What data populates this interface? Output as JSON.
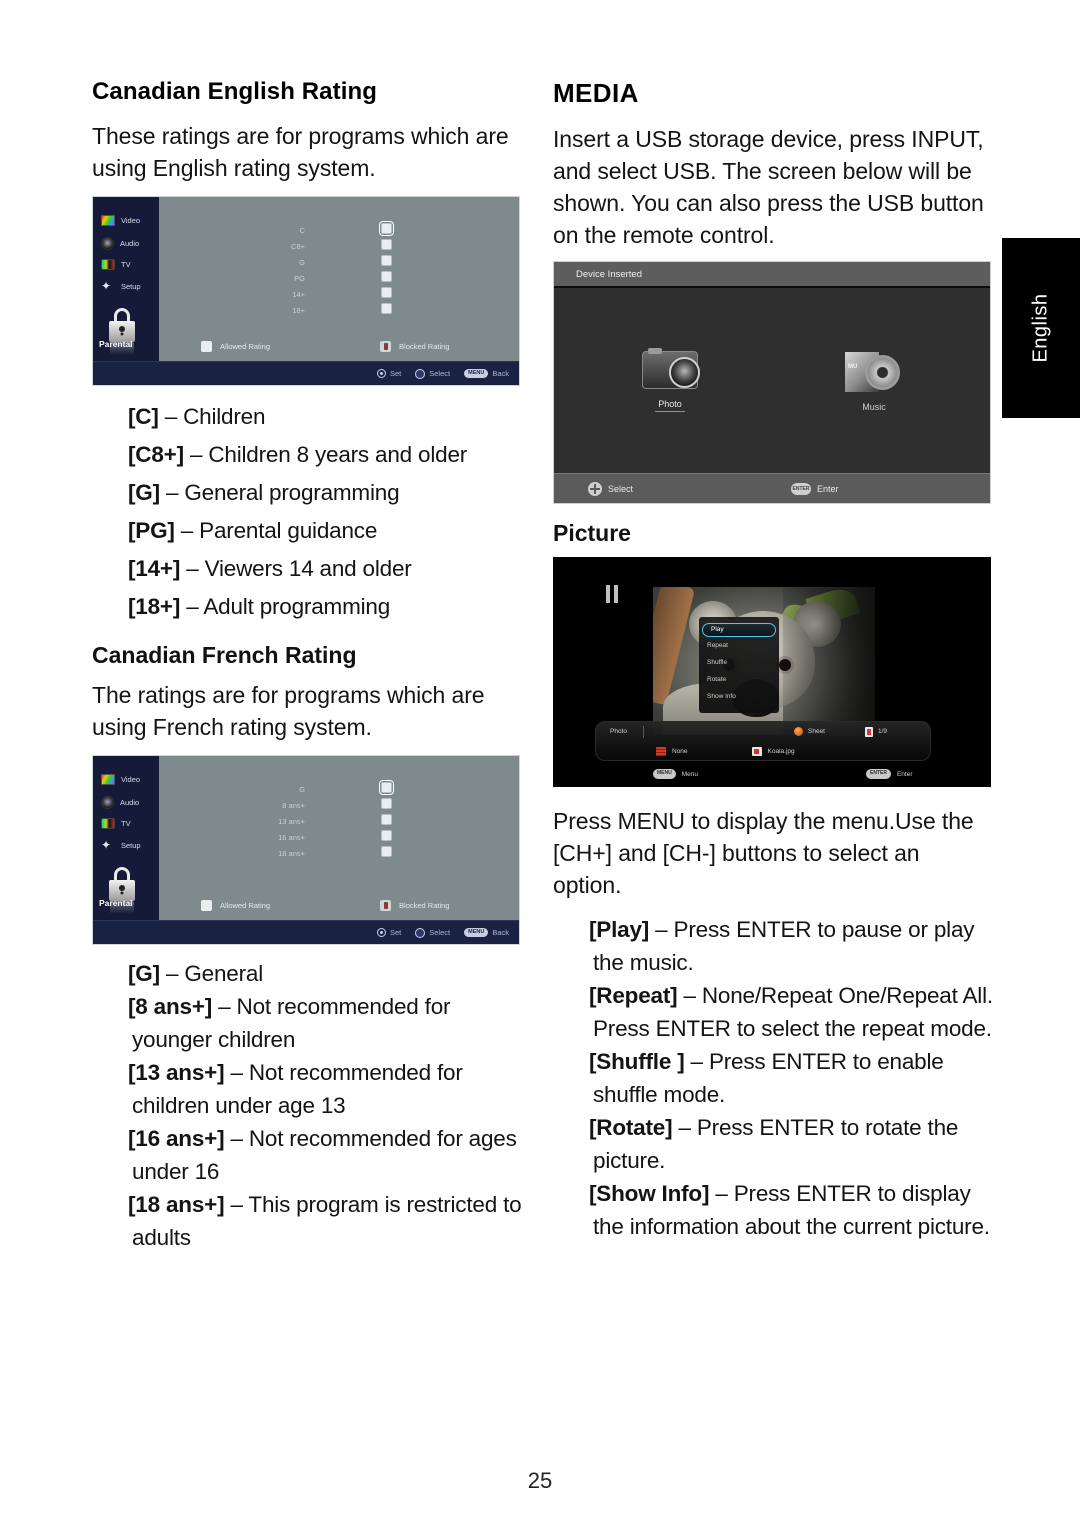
{
  "page": {
    "number": "25",
    "language_tab": "English"
  },
  "left": {
    "heading_english": "Canadian English Rating",
    "intro_english": "These ratings are for programs which are using English rating system.",
    "english_osd": {
      "sidebar": [
        {
          "label": "Video",
          "icon": "video-icon"
        },
        {
          "label": "Audio",
          "icon": "audio-icon"
        },
        {
          "label": "TV",
          "icon": "tv-icon"
        },
        {
          "label": "Setup",
          "icon": "setup-icon"
        },
        {
          "label": "Parental",
          "icon": "lock-icon"
        }
      ],
      "ratings": [
        "C",
        "C8+",
        "G",
        "PG",
        "14+",
        "18+"
      ],
      "legend_allowed": "Allowed Rating",
      "legend_blocked": "Blocked Rating",
      "footer": {
        "set": "Set",
        "select": "Select",
        "back": "Back",
        "menu_key": "MENU"
      }
    },
    "english_defs": [
      {
        "term": "[C]",
        "dash": "–",
        "desc": "Children"
      },
      {
        "term": "[C8+]",
        "dash": "–",
        "desc": "Children 8 years and older"
      },
      {
        "term": "[G]",
        "dash": "–",
        "desc": "General programming"
      },
      {
        "term": "[PG]",
        "dash": "–",
        "desc": "Parental guidance"
      },
      {
        "term": "[14+]",
        "dash": "–",
        "desc": "Viewers 14 and older"
      },
      {
        "term": "[18+]",
        "dash": "–",
        "desc": "Adult programming"
      }
    ],
    "heading_french": "Canadian French Rating",
    "intro_french": "The ratings are for programs  which are using French rating system.",
    "french_osd": {
      "sidebar": [
        {
          "label": "Video",
          "icon": "video-icon"
        },
        {
          "label": "Audio",
          "icon": "audio-icon"
        },
        {
          "label": "TV",
          "icon": "tv-icon"
        },
        {
          "label": "Setup",
          "icon": "setup-icon"
        },
        {
          "label": "Parental",
          "icon": "lock-icon"
        }
      ],
      "ratings": [
        "G",
        "8 ans+",
        "13 ans+",
        "16 ans+",
        "18 ans+"
      ],
      "legend_allowed": "Allowed Rating",
      "legend_blocked": "Blocked Rating",
      "footer": {
        "set": "Set",
        "select": "Select",
        "back": "Back",
        "menu_key": "MENU"
      }
    },
    "french_defs": [
      {
        "term": "[G]",
        "dash": "–",
        "desc": "General"
      },
      {
        "term": "[8 ans+]",
        "dash": "–",
        "desc": "Not recommended for younger children"
      },
      {
        "term": "[13 ans+]",
        "dash": "–",
        "desc": "Not recommended for children under age 13"
      },
      {
        "term": "[16 ans+]",
        "dash": "–",
        "desc": "Not recommended for ages under 16"
      },
      {
        "term": "[18 ans+]",
        "dash": "–",
        "desc": "This program is restricted to adults"
      }
    ]
  },
  "right": {
    "heading_media": "MEDIA",
    "intro_media": "Insert a USB storage device, press INPUT, and select USB. The screen below will be shown. You can also press the USB button on the remote control.",
    "device_screen": {
      "title": "Device Inserted",
      "items": [
        {
          "label": "Photo",
          "icon": "camera-icon",
          "selected": true
        },
        {
          "label": "Music",
          "icon": "cd-icon",
          "selected": false
        }
      ],
      "footer": {
        "select": "Select",
        "enter": "Enter",
        "enter_key": "ENTER"
      }
    },
    "heading_picture": "Picture",
    "picture_screen": {
      "options": [
        {
          "label": "Play",
          "selected": true
        },
        {
          "label": "Repeat",
          "selected": false
        },
        {
          "label": "Shuffle",
          "selected": false
        },
        {
          "label": "Rotate",
          "selected": false
        },
        {
          "label": "Show Info",
          "selected": false
        }
      ],
      "infobar": {
        "mode": "Photo",
        "sheet_label": "Sheet",
        "count": "1/9",
        "repeat_label": "None",
        "file_name": "Koala.jpg"
      },
      "footer": {
        "menu": "Menu",
        "menu_key": "MENU",
        "enter": "Enter",
        "enter_key": "ENTER"
      }
    },
    "intro_menu": "Press MENU to display the menu.Use the [CH+] and [CH-] buttons to select an option.",
    "picture_defs": [
      {
        "term": "[Play]",
        "dash": "–",
        "desc": "Press ENTER to pause or play the music."
      },
      {
        "term": "[Repeat]",
        "dash": "–",
        "desc": "None/Repeat One/Repeat All. Press ENTER to select the repeat mode."
      },
      {
        "term": "[Shuffle ]",
        "dash": "–",
        "desc": "Press ENTER to enable shuffle mode."
      },
      {
        "term": "[Rotate]",
        "dash": "–",
        "desc": "Press ENTER to rotate the picture."
      },
      {
        "term": "[Show Info]",
        "dash": "–",
        "desc": "Press ENTER to display the information about the current picture."
      }
    ]
  }
}
